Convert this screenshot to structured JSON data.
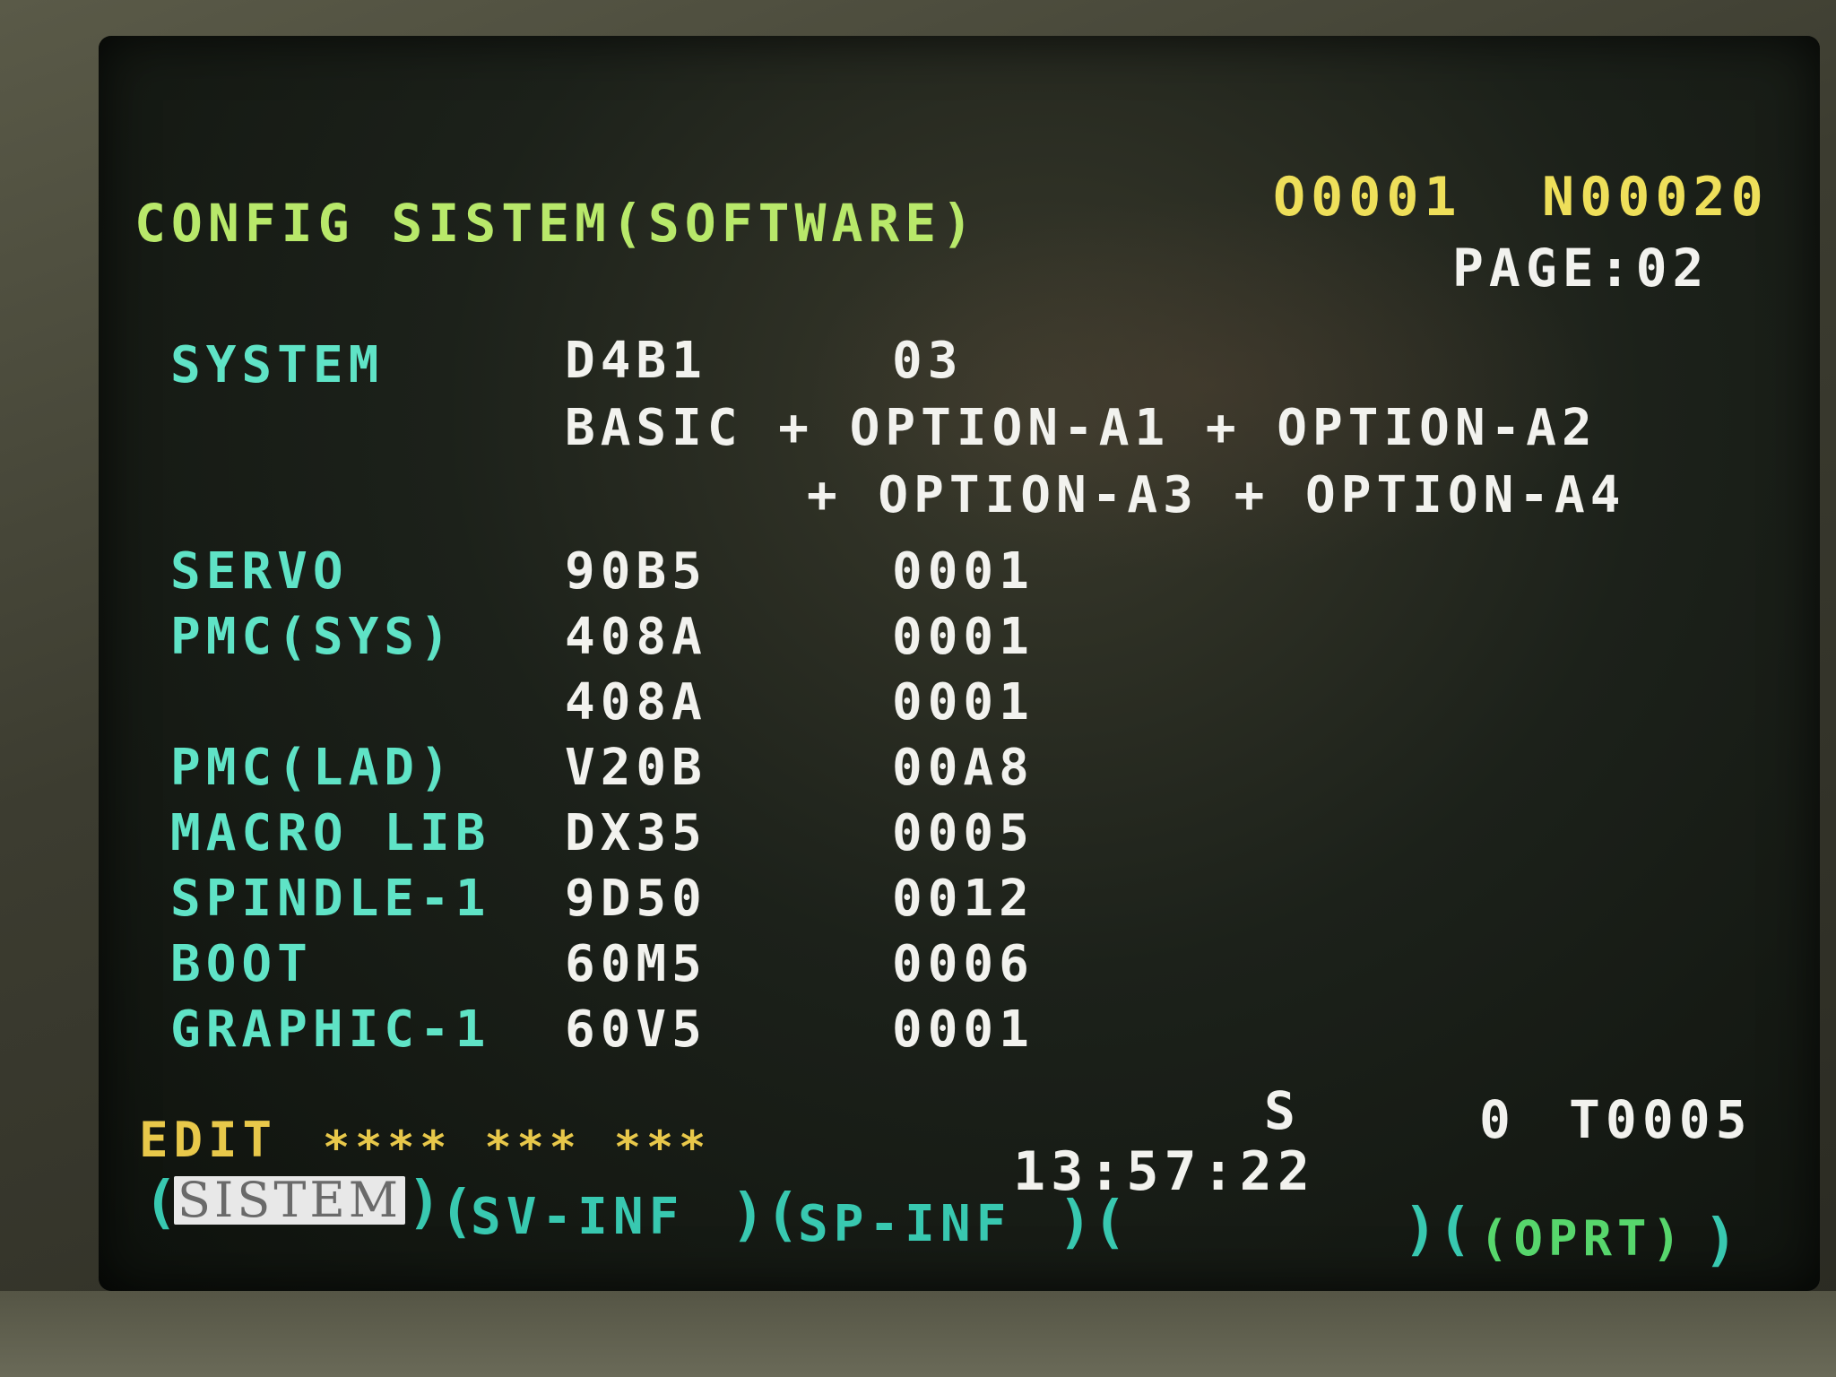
{
  "header": {
    "title": "CONFIG SISTEM(SOFTWARE)",
    "program_number": "O0001",
    "sequence_number": "N00020",
    "page": "PAGE:02"
  },
  "rows": [
    {
      "label": "SYSTEM",
      "id": "D4B1",
      "version": "03"
    },
    {
      "label": "SERVO",
      "id": "90B5",
      "version": "0001"
    },
    {
      "label": "PMC(SYS)",
      "id": "408A",
      "version": "0001"
    },
    {
      "label": "",
      "id": "408A",
      "version": "0001"
    },
    {
      "label": "PMC(LAD)",
      "id": "V20B",
      "version": "00A8"
    },
    {
      "label": "MACRO LIB",
      "id": "DX35",
      "version": "0005"
    },
    {
      "label": "SPINDLE-1",
      "id": "9D50",
      "version": "0012"
    },
    {
      "label": "BOOT",
      "id": "60M5",
      "version": "0006"
    },
    {
      "label": "GRAPHIC-1",
      "id": "60V5",
      "version": "0001"
    }
  ],
  "options": {
    "line1": "BASIC + OPTION-A1 + OPTION-A2",
    "line2": "+ OPTION-A3 + OPTION-A4"
  },
  "status": {
    "mode": "EDIT",
    "stars": "**** *** ***",
    "spindle_label": "S",
    "spindle_value": "0",
    "tool": "T0005",
    "time": "13:57:22"
  },
  "softkeys": {
    "k1": "SISTEM",
    "k2": "SV-INF",
    "k3": "SP-INF",
    "k4": "",
    "k5": "(OPRT)"
  },
  "colors": {
    "title": "#b8e86a",
    "header_numbers": "#eedf5a",
    "labels": "#5fe3c6",
    "values": "#f2f2ee",
    "softkeys": "#38c8b0",
    "oprt": "#57d66c",
    "status": "#e8c84a"
  }
}
